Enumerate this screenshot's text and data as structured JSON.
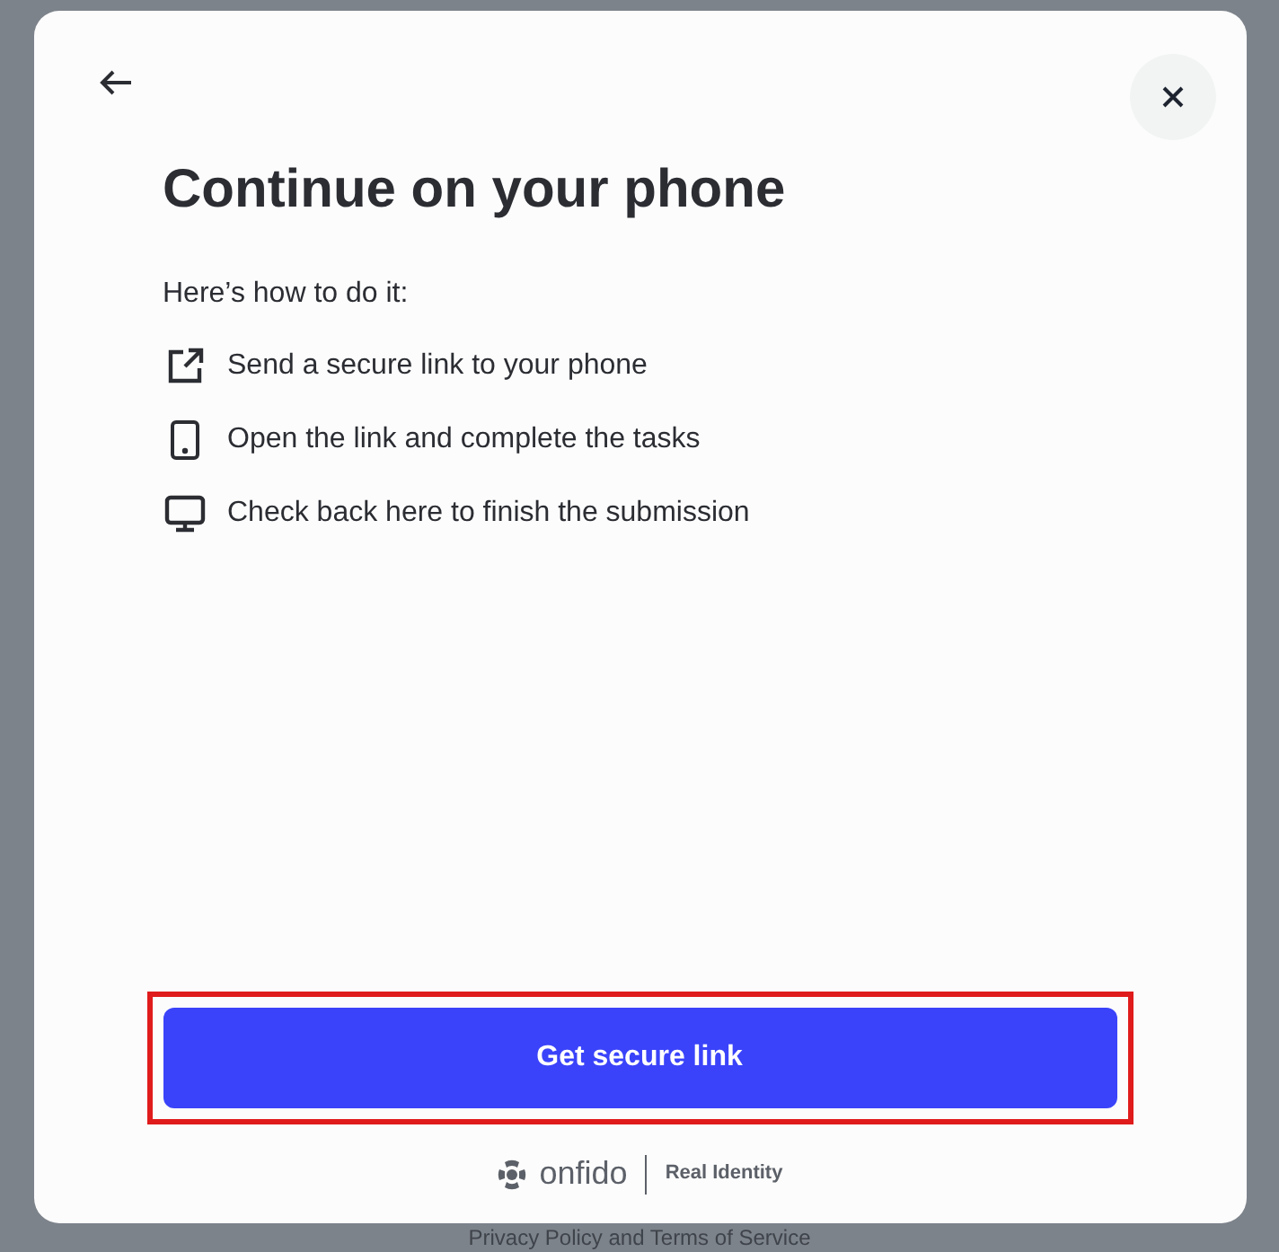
{
  "modal": {
    "title": "Continue on your phone",
    "intro": "Here’s how to do it:",
    "steps": [
      {
        "kind": "link",
        "text": "Send a secure link to your phone"
      },
      {
        "kind": "phone",
        "text": "Open the link and complete the tasks"
      },
      {
        "kind": "desktop",
        "text": "Check back here to finish the submission"
      }
    ],
    "primary_button": {
      "label": "Get secure link",
      "highlighted": true
    },
    "footer": {
      "brand": "onfido",
      "tagline": "Real Identity"
    }
  },
  "background_footer": {
    "links": "Privacy Policy and Terms of Service"
  }
}
